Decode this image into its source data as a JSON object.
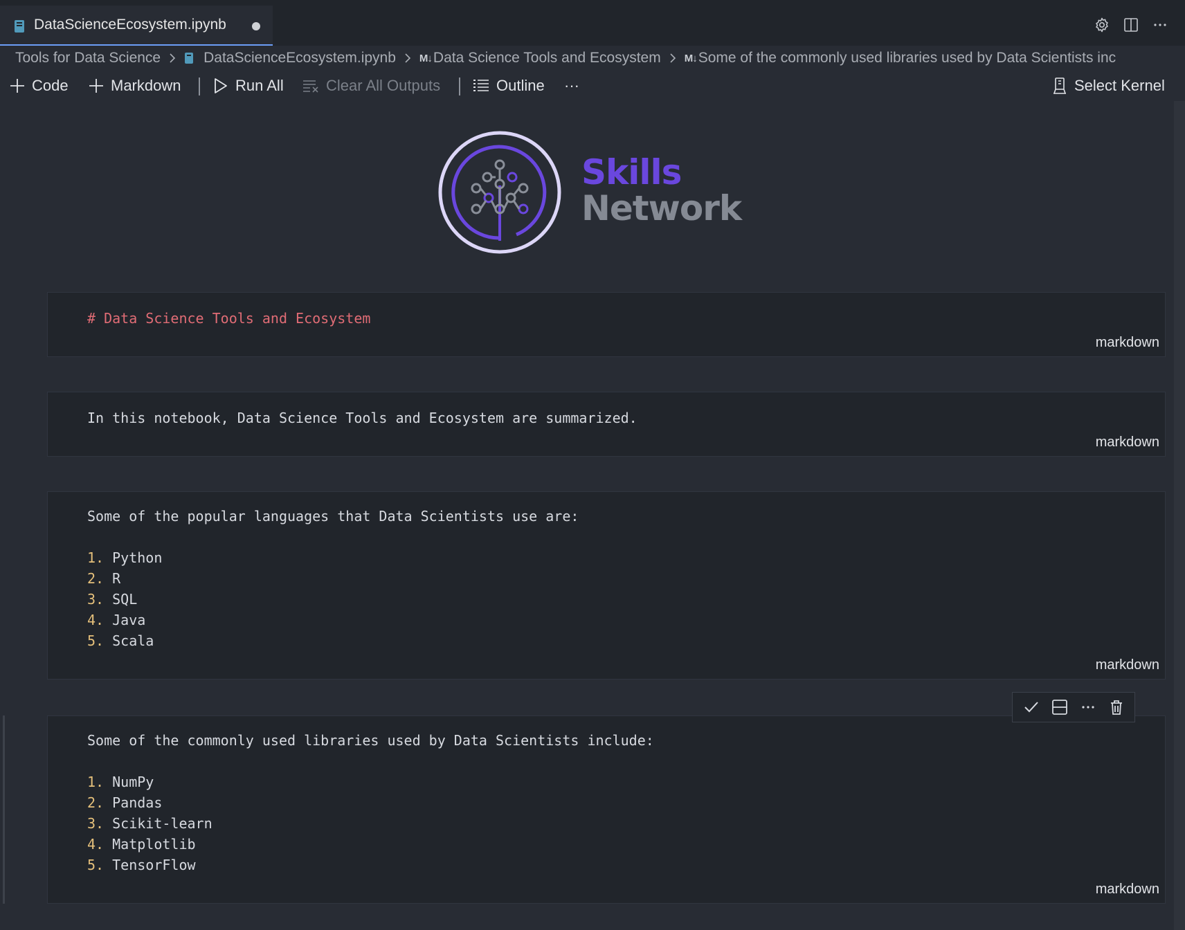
{
  "tab": {
    "title": "DataScienceEcosystem.ipynb",
    "dirty": true
  },
  "breadcrumb": {
    "folder": "Tools for Data Science",
    "file": "DataScienceEcosystem.ipynb",
    "md_marker": "M↓",
    "section1": "Data Science Tools and Ecosystem",
    "section2": "Some of the commonly used libraries used by Data Scientists inc"
  },
  "toolbar": {
    "code_label": "Code",
    "markdown_label": "Markdown",
    "run_all_label": "Run All",
    "clear_outputs_label": "Clear All Outputs",
    "outline_label": "Outline",
    "more_label": "···",
    "select_kernel_label": "Select Kernel"
  },
  "logo": {
    "line1": "Skills",
    "line2": "Network"
  },
  "cells": [
    {
      "type": "markdown",
      "heading": "# Data Science Tools and Ecosystem"
    },
    {
      "type": "markdown",
      "text": "In this notebook, Data Science Tools and Ecosystem are summarized."
    },
    {
      "type": "markdown",
      "intro": "Some of the popular languages that Data Scientists use are:",
      "items": [
        {
          "num": "1.",
          "text": "Python"
        },
        {
          "num": "2.",
          "text": "R"
        },
        {
          "num": "3.",
          "text": "SQL"
        },
        {
          "num": "4.",
          "text": "Java"
        },
        {
          "num": "5.",
          "text": "Scala"
        }
      ]
    },
    {
      "type": "markdown",
      "intro": "Some of the commonly used libraries used by Data Scientists include:",
      "items": [
        {
          "num": "1.",
          "text": "NumPy"
        },
        {
          "num": "2.",
          "text": "Pandas"
        },
        {
          "num": "3.",
          "text": "Scikit-learn"
        },
        {
          "num": "4.",
          "text": "Matplotlib"
        },
        {
          "num": "5.",
          "text": "TensorFlow"
        }
      ]
    }
  ],
  "cell_lang_label": "markdown",
  "colors": {
    "background": "#282c34",
    "cell_background": "#21252b",
    "heading": "#e06c75",
    "list_number": "#e5c07b",
    "brand_purple": "#6a47de",
    "active_tab_border": "#6c9ef8"
  }
}
